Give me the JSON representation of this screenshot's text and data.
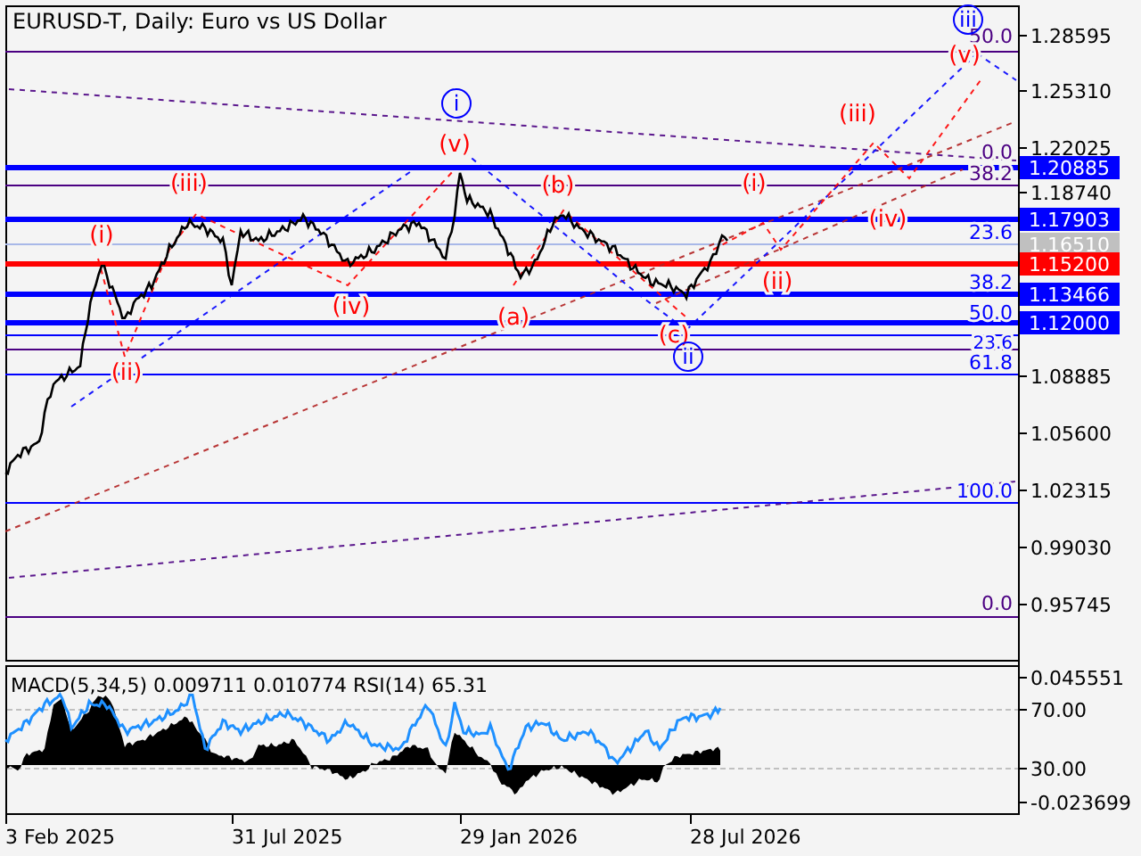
{
  "chart": {
    "title": "EURUSD-T, Daily:  Euro vs US Dollar",
    "price_axis": [
      "1.28595",
      "1.25310",
      "1.22025",
      "1.18740",
      "1.08885",
      "1.05600",
      "1.02315",
      "0.99030",
      "0.95745"
    ],
    "price_tags": [
      {
        "value": "1.20885",
        "color": "#0000ff"
      },
      {
        "value": "1.17903",
        "color": "#0000ff"
      },
      {
        "value": "1.16510",
        "color": "#c0c0c0"
      },
      {
        "value": "1.15200",
        "color": "#ff0000"
      },
      {
        "value": "1.13466",
        "color": "#0000ff"
      },
      {
        "value": "1.12000",
        "color": "#0000ff"
      }
    ],
    "fib_labels": [
      {
        "text": "50.0",
        "color": "#4b0082"
      },
      {
        "text": "0.0",
        "color": "#4b0082"
      },
      {
        "text": "38.2",
        "color": "#4b0082"
      },
      {
        "text": "23.6",
        "color": "#0000ff"
      },
      {
        "text": "38.2",
        "color": "#0000ff"
      },
      {
        "text": "50.0",
        "color": "#0000ff"
      },
      {
        "text": "23.6",
        "color": "#0000ff"
      },
      {
        "text": "61.8",
        "color": "#0000ff"
      },
      {
        "text": "100.0",
        "color": "#0000ff"
      },
      {
        "text": "0.0",
        "color": "#4b0082"
      }
    ],
    "wave_labels": [
      {
        "text": "(i)",
        "kind": "minor"
      },
      {
        "text": "(ii)",
        "kind": "minor"
      },
      {
        "text": "(iii)",
        "kind": "minor"
      },
      {
        "text": "(iv)",
        "kind": "minor"
      },
      {
        "text": "(v)",
        "kind": "minor"
      },
      {
        "text": "i",
        "kind": "major"
      },
      {
        "text": "(a)",
        "kind": "minor"
      },
      {
        "text": "(b)",
        "kind": "minor"
      },
      {
        "text": "(c)",
        "kind": "minor"
      },
      {
        "text": "ii",
        "kind": "major"
      },
      {
        "text": "(i)",
        "kind": "minor"
      },
      {
        "text": "(ii)",
        "kind": "minor"
      },
      {
        "text": "(iii)",
        "kind": "minor"
      },
      {
        "text": "(iv)",
        "kind": "minor"
      },
      {
        "text": "(v)",
        "kind": "minor"
      },
      {
        "text": "iii",
        "kind": "major"
      }
    ],
    "indicator": {
      "title": "MACD(5,34,5) 0.009711 0.010774 RSI(14) 65.31",
      "axis": [
        "0.045551",
        "70.00",
        "30.00",
        "-0.023699"
      ]
    },
    "date_axis": [
      "3 Feb 2025",
      "31 Jul 2025",
      "29 Jan 2026",
      "28 Jul 2026"
    ]
  }
}
